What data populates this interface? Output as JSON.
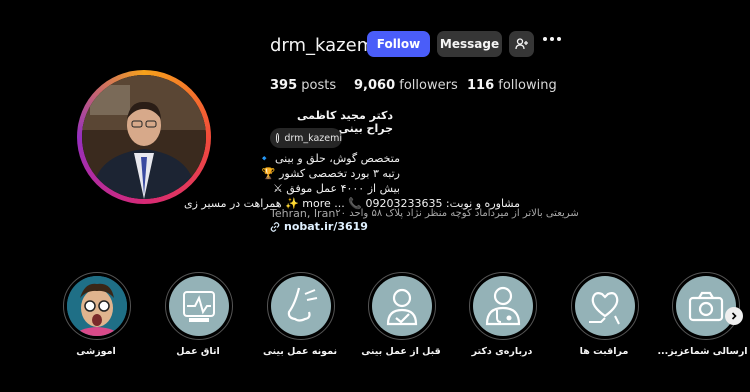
{
  "profile": {
    "username": "drm_kazemi",
    "follow_label": "Follow",
    "message_label": "Message",
    "posts_count": "395",
    "posts_label": "posts",
    "followers_count": "9,060",
    "followers_label": "followers",
    "following_count": "116",
    "following_label": "following",
    "display_name": "دکتر مجید کاظمی جراح بینی",
    "threads_handle": "drm_kazemi",
    "bio_lines": [
      "متخصص گوش، حلق و بینی 🔹",
      "رتبه ۳ بورد تخصصی کشور 🏆",
      "بیش از ۴۰۰۰ عمل موفق ⚔",
      "مشاوره و نوبت: 09203233635 📞 ... more ✨ همراهت در مسیر زی"
    ],
    "bio_address_line": "شریعتی بالاتر از میرداماد کوچه منظر نژاد پلاک ۵۸ واحد ۲۰",
    "bio_location": "Tehran, Iran",
    "link": "nobat.ir/3619"
  },
  "highlights": [
    {
      "label": "آموزشی",
      "icon": "person-face-photo"
    },
    {
      "label": "اتاق عمل",
      "icon": "operating-room-icon"
    },
    {
      "label": "نمونه عمل بینی",
      "icon": "nose-shape-icon"
    },
    {
      "label": "قبل از عمل بینی",
      "icon": "patient-icon"
    },
    {
      "label": "درباره‌ی دکتر",
      "icon": "doctor-icon"
    },
    {
      "label": "مراقبت ها",
      "icon": "care-icon"
    },
    {
      "label": "ارسالی شماعزیز...",
      "icon": "camera-icon"
    }
  ],
  "colors": {
    "follow_button": "#4a5df9",
    "secondary_button": "#363636",
    "highlight_bg": "#94b2b7"
  }
}
